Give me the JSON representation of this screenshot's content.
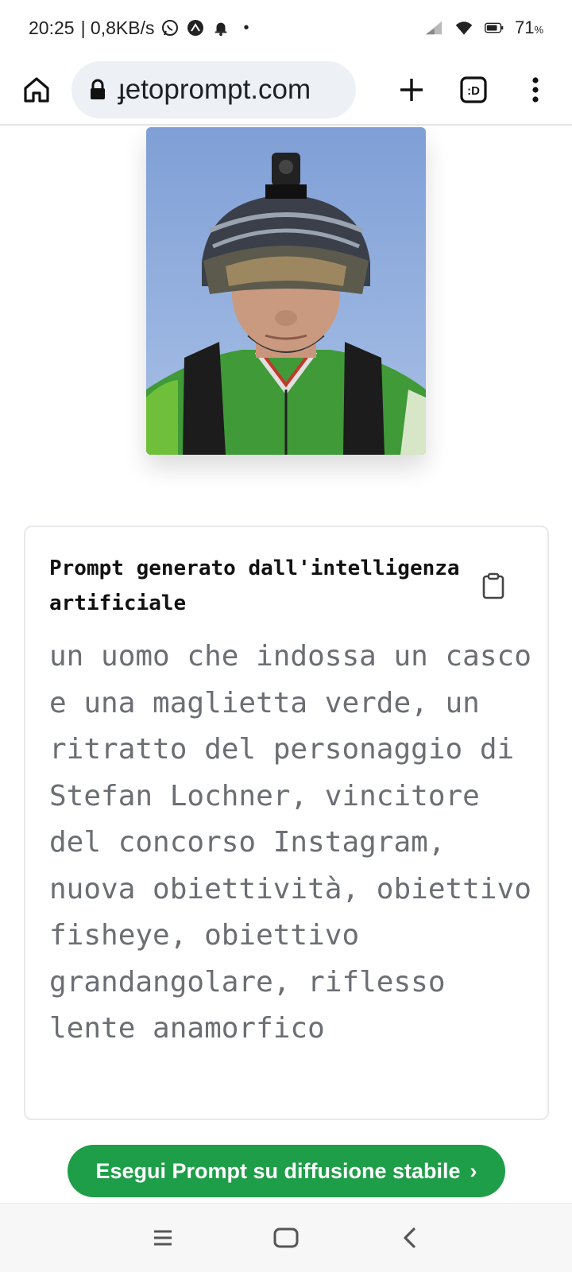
{
  "status_bar": {
    "time": "20:25",
    "speed": "| 0,8KB/s",
    "battery": "71",
    "battery_unit": "%",
    "icons": [
      "whatsapp-icon",
      "app-icon",
      "bell-icon",
      "dot-icon",
      "signal-icon",
      "wifi-icon",
      "battery-icon"
    ]
  },
  "browser": {
    "url": "ɟetoprompt.com",
    "icons": [
      "home-icon",
      "lock-icon",
      "plus-icon",
      "tab-switcher-icon",
      "more-vert-icon"
    ],
    "tab_label": ":D"
  },
  "card": {
    "title": "Prompt generato dall'intelligenza artificiale",
    "prompt": "un uomo che indossa un casco e una maglietta verde, un ritratto del personaggio di Stefan Lochner, vincitore del concorso Instagram, nuova obiettività, obiettivo fisheye, obiettivo grandangolare, riflesso lente anamorfico"
  },
  "cta": {
    "label": "Esegui Prompt su diffusione stabile",
    "arrow": "›",
    "color": "#1e9e48"
  },
  "nav_bar": {
    "icons": [
      "menu-icon",
      "home-square-icon",
      "back-icon"
    ]
  }
}
